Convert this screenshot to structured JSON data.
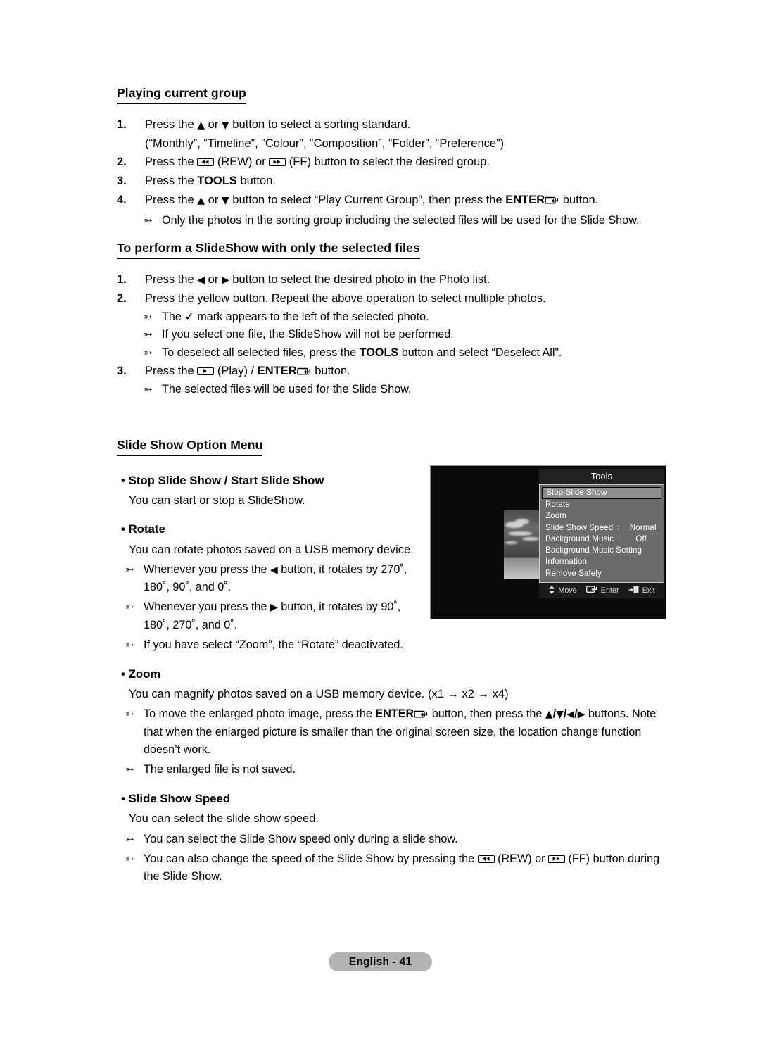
{
  "document": {
    "page_label": "English - 41"
  },
  "sections": {
    "playing_current_group": {
      "heading": "Playing current group",
      "steps": [
        {
          "num": "1.",
          "text_before": "Press the ",
          "text_after": " button to select a sorting standard."
        },
        {
          "num": "2.",
          "text_before": "Press the ",
          "text_mid": " (REW) or ",
          "text_after": " (FF) button to select the desired group."
        },
        {
          "num": "3.",
          "text_before": "Press the ",
          "bold": "TOOLS",
          "text_after": " button."
        },
        {
          "num": "4.",
          "text_before": "Press the ",
          "text_mid": " button to select “Play Current Group”, then press the ",
          "bold": "ENTER",
          "text_after": " button."
        }
      ],
      "sorting_options": "(“Monthly”, “Timeline”, “Colour”, “Composition”, “Folder”, “Preference”)",
      "note": "Only the photos in the sorting group including the selected files will be used for the Slide Show."
    },
    "slideshow_selected_files": {
      "heading": "To perform a SlideShow with only the selected files",
      "step1_before": "Press the ",
      "step1_after": " button to select the desired photo in the Photo list.",
      "step1_num": "1.",
      "step2_num": "2.",
      "step2": "Press the yellow button. Repeat the above operation to select multiple photos.",
      "note_check_before": "The ",
      "note_check_after": " mark appears to the left of the selected photo.",
      "note_one_file": "If you select one file, the SlideShow will not be performed.",
      "note_deselect_before": "To deselect all selected files, press the ",
      "note_deselect_bold": "TOOLS",
      "note_deselect_after": " button and select “Deselect All”.",
      "step3_num": "3.",
      "step3_before": "Press the ",
      "step3_mid": " (Play) / ",
      "step3_bold": "ENTER",
      "step3_after": " button.",
      "note_selected": "The selected files will be used for the Slide Show."
    },
    "option_menu": {
      "heading": "Slide Show Option Menu",
      "options": [
        {
          "title": "Stop Slide Show / Start Slide Show",
          "desc": "You can start or stop a SlideShow."
        },
        {
          "title": "Rotate",
          "desc": "You can rotate photos saved on a USB memory device.",
          "notes": [
            {
              "before": "Whenever you press the ",
              "after": " button, it rotates by 270˚, 180˚, 90˚, and 0˚."
            },
            {
              "before": "Whenever you press the ",
              "after": " button, it rotates by 90˚, 180˚, 270˚, and 0˚."
            },
            {
              "plain": "If you have select “Zoom”, the “Rotate” deactivated."
            }
          ]
        },
        {
          "title": "Zoom",
          "desc": "You can magnify photos saved on a USB memory device. (x1 → x2 → x4)",
          "note_move_a": "To move the enlarged photo image, press the ",
          "note_move_bold": "ENTER",
          "note_move_b": " button, then press the ",
          "note_move_c": " buttons.  Note that when the enlarged picture is smaller than the original screen size, the location change function doesn’t work.",
          "note_not_saved": "The enlarged file is not saved."
        },
        {
          "title": "Slide Show Speed",
          "desc": "You can select the slide show speed.",
          "note_during": "You can select the Slide Show speed only during a slide show.",
          "note_rew_a": "You can also change the speed of the Slide Show by pressing the ",
          "note_rew_b": " (REW) or ",
          "note_rew_c": " (FF) button during the Slide Show."
        }
      ]
    }
  },
  "tv_screenshot": {
    "menu_title": "Tools",
    "items": [
      {
        "label": "Stop Slide Show",
        "selected": true
      },
      {
        "label": "Rotate",
        "selected": false
      },
      {
        "label": "Zoom",
        "selected": false
      },
      {
        "label": "Slide Show Speed",
        "colon": ":",
        "value": "Normal",
        "selected": false
      },
      {
        "label": "Background Music",
        "colon": ":",
        "value": "Off",
        "selected": false
      },
      {
        "label": "Background Music Setting",
        "selected": false
      },
      {
        "label": "Information",
        "selected": false
      },
      {
        "label": "Remove Safely",
        "selected": false
      }
    ],
    "footer": [
      {
        "icon": "updown-arrow-icon",
        "label": "Move"
      },
      {
        "icon": "enter-icon",
        "label": "Enter"
      },
      {
        "icon": "exit-icon",
        "label": "Exit"
      }
    ]
  },
  "colors": {
    "menu_list_bg": "#6b6b6b",
    "menu_title_bg": "#232323",
    "selected_bg": "#8e8e8e",
    "page_badge_bg": "#b3b3b3"
  }
}
